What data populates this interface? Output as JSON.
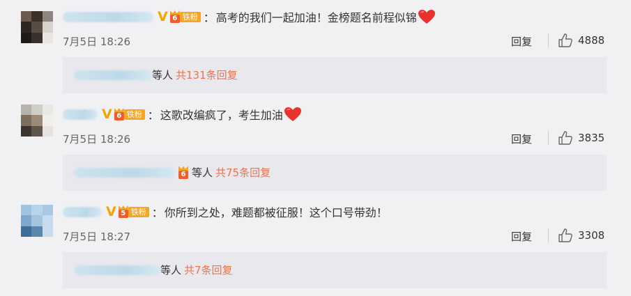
{
  "comments": [
    {
      "text": "高考的我们一起加油！金榜题名前程似锦",
      "fan_badge": {
        "level": "6",
        "label": "铁粉"
      },
      "time": "7月5日 18:26",
      "reply_label": "回复",
      "likes": "4888",
      "sub": {
        "suffix": "等人",
        "more": "共131条回复"
      }
    },
    {
      "text": "这歌改编疯了，考生加油",
      "fan_badge": {
        "level": "6",
        "label": "铁粉"
      },
      "time": "7月5日 18:26",
      "reply_label": "回复",
      "likes": "3835",
      "sub": {
        "suffix": "等人",
        "more": "共75条回复"
      }
    },
    {
      "text": "你所到之处，难题都被征服！这个口号带劲！",
      "fan_badge": {
        "level": "5",
        "label": "铁粉"
      },
      "time": "7月5日 18:27",
      "reply_label": "回复",
      "likes": "3308",
      "sub": {
        "suffix": "等人",
        "more": "共7条回复"
      }
    }
  ],
  "colors": {
    "vip": "#f5a400",
    "link": "#eb7350",
    "badge": "#f5a623",
    "heart": "#e8322e"
  },
  "icons": {
    "like": "thumbs-up-icon",
    "vip": "vip-v-icon",
    "heart": "heart-icon",
    "crown": "crown-icon"
  },
  "colon": "："
}
